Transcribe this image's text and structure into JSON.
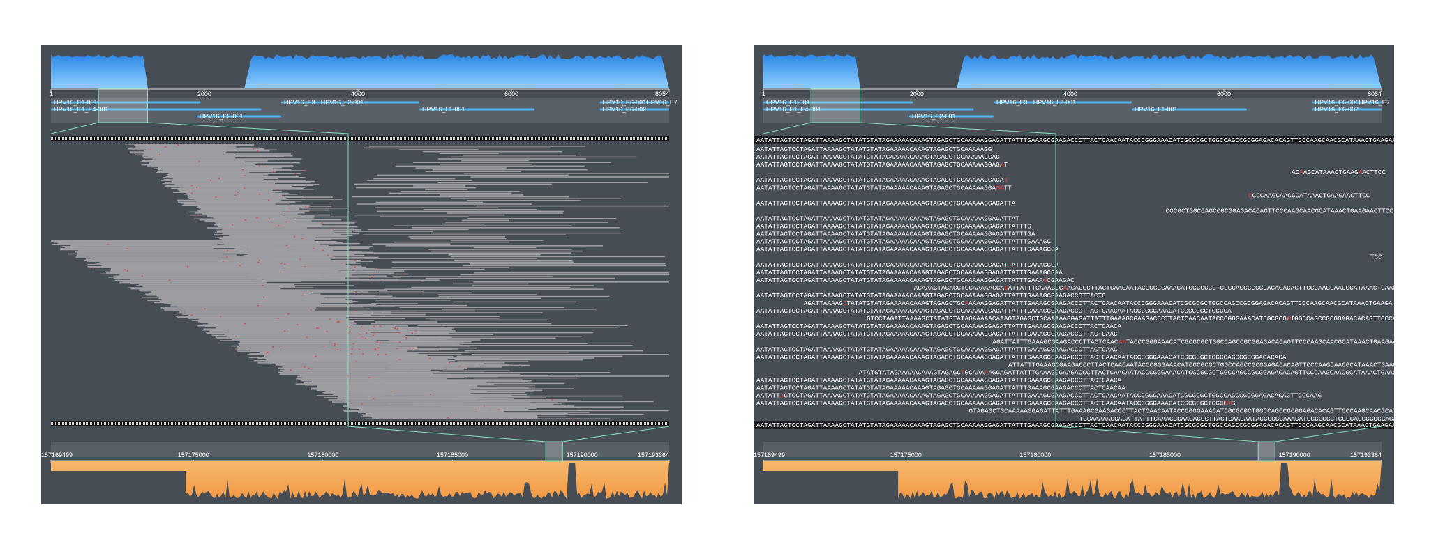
{
  "colors": {
    "panel_bg": "#474d55",
    "coverage_top": "#3d9bef",
    "coverage_bottom": "#f5a85a",
    "gene_track": "#4fb6f0",
    "read": "#9e9ea2",
    "mismatch": "#e0443a",
    "connector": "#7fe0b8"
  },
  "left_view": {
    "mode": "alignment-overview"
  },
  "right_view": {
    "mode": "sequence-detail"
  },
  "top_axis": {
    "ticks": [
      "1",
      "2000",
      "4000",
      "6000",
      "8054"
    ],
    "tick_values": [
      1,
      2000,
      4000,
      6000,
      8054
    ],
    "max": 8054,
    "coverage_gap": [
      1260,
      2520
    ],
    "selection": [
      620,
      1260
    ]
  },
  "genes": [
    {
      "label": "HPV16_E1-001",
      "start": 1,
      "end": 1950,
      "row": 0
    },
    {
      "label": "HPV16_E1_E4-001",
      "start": 1,
      "end": 2740,
      "row": 1
    },
    {
      "label": "HPV16_E2-001",
      "start": 1900,
      "end": 3000,
      "row": 2
    },
    {
      "label": "HPV16_E3",
      "start": 3000,
      "end": 3540,
      "row": 0
    },
    {
      "label": "HPV16_L2-001",
      "start": 3480,
      "end": 4800,
      "row": 0
    },
    {
      "label": "HPV16_L1-001",
      "start": 4800,
      "end": 6300,
      "row": 1
    },
    {
      "label": "HPV16_E6-001",
      "start": 7150,
      "end": 7720,
      "row": 0
    },
    {
      "label": "HPV16_E7",
      "start": 7720,
      "end": 8054,
      "row": 0
    },
    {
      "label": "HPV16_E6-002",
      "start": 7150,
      "end": 8054,
      "row": 1
    }
  ],
  "bottom_axis": {
    "ticks": [
      "157169499",
      "157175000",
      "157180000",
      "157185000",
      "157190000",
      "157193364"
    ],
    "tick_values": [
      157169499,
      157175000,
      157180000,
      157185000,
      157190000,
      157193364
    ],
    "min": 157169499,
    "max": 157193364,
    "selection": [
      157188600,
      157189250
    ],
    "coverage_step": 157174700
  },
  "sequences": {
    "reference": "AATATTAGTCCTAGATTAAAAGCTATATGTATAGAAAAACAAAGTAGAGCTGCAAAAAGGAGATTATTTGAAAGCGAAGACCCTTACTCAACAATACCCGGGAAACATCGCGCGCTGGCCAGCCGCGGAGACACAGTTCCCAAGCAACGCATAAACTGAAGAACTTCC",
    "reads": [
      {
        "offset": 0,
        "text": "AATATTAGTCCTAGATTAAAAGCTATATGTATAGAAAAACAAAGTAGAGCTGCAAAAAGG",
        "mismatch": []
      },
      {
        "offset": 0,
        "text": "AATATTAGTCCTAGATTAAAAGCTATATGTATAGAAAAACAAAGTAGAGCTGCAAAAAGGAG",
        "mismatch": []
      },
      {
        "offset": 0,
        "text": "AATATTAGTCCTAGATTAAAAGCTATATGTATAGAAAAACAAAGTAGAGCTGCAAAAAGGAGAT",
        "mismatch": [
          62
        ]
      },
      {
        "offset": 136,
        "text": "ACAAGCATAAACTGAAGAACTTCC",
        "mismatch": [
          2,
          17
        ]
      },
      {
        "offset": 0,
        "text": "AATATTAGTCCTAGATTAAAAGCTATATGTATAGAAAAACAAAGTAGAGCTGCAAAAAGGAGAT",
        "mismatch": [
          63
        ]
      },
      {
        "offset": 0,
        "text": "AATATTAGTCCTAGATTAAAAGCTATATGTATAGAAAAACAAAGTAGAGCTGCAAAAAGGAGATT",
        "mismatch": [
          61,
          62
        ]
      },
      {
        "offset": 125,
        "text": "CCCCAAGCAACGCATAAACTGAAGAACTTCC",
        "mismatch": [
          0
        ]
      },
      {
        "offset": 0,
        "text": "AATATTAGTCCTAGATTAAAAGCTATATGTATAGAAAAACAAAGTAGAGCTGCAAAAAGGAGATTA",
        "mismatch": []
      },
      {
        "offset": 104,
        "text": "CGCGCTGGCCAGCCGCGGAGACACAGTTCCCAAGCAACGCATAAACTGAAGAACTTCC",
        "mismatch": []
      },
      {
        "offset": 0,
        "text": "AATATTAGTCCTAGATTAAAAGCTATATGTATAGAAAAACAAAGTAGAGCTGCAAAAAGGAGATTAT",
        "mismatch": []
      },
      {
        "offset": 0,
        "text": "AATATTAGTCCTAGATTAAAAGCTATATGTATAGAAAAACAAAGTAGAGCTGCAAAAAGGAGATTATTTG",
        "mismatch": []
      },
      {
        "offset": 0,
        "text": "AATATTAGTCCTAGATTAAAAGCTATATGTATAGAAAAACAAAGTAGAGCTGCAAAAAGGAGATTATTTGA",
        "mismatch": []
      },
      {
        "offset": 0,
        "text": "AATATTAGTCCTAGATTAAAAGCTATATGTATAGAAAAACAAAGTAGAGCTGCAAAAAGGAGATTATTTGAAAGC",
        "mismatch": []
      },
      {
        "offset": 0,
        "text": "AATATTAGTCCTAGATTAAAAGCTATATGTATAGAAAAACAAAGTAGAGCTGCAAAAAGGAGATTATTTGAAAGCGA",
        "mismatch": []
      },
      {
        "offset": 156,
        "text": "TCC",
        "mismatch": []
      },
      {
        "offset": 0,
        "text": "AATATTAGTCCTAGATTAAAAGCTATATGTATAGAAAAACAAAGTAGAGCTGCAAAAAGGAGATTATTTGAAAGCGA",
        "mismatch": [
          64
        ]
      },
      {
        "offset": 0,
        "text": "AATATTAGTCCTAGATTAAAAGCTATATGTATAGAAAAACAAAGTAGAGCTGCAAAAAGGAGATTATTTGAAAGCGAA",
        "mismatch": []
      },
      {
        "offset": 0,
        "text": "AATATTAGTCCTAGATTAAAAGCTATATGTATAGAAAAACAAAGTAGAGCTGCAAAAAGGAGATTATTTGAAAGCGAAGAC",
        "mismatch": [
          73
        ]
      },
      {
        "offset": 40,
        "text": "ACAAAGTAGAGCTGCAAAAAGGAGATTATTTGAAAGCGAAGACCCTTACTCAACAATACCCGGGAAACATCGCGCGCTGGCCAGCCGCGGAGACACAGTTCCCAAGCAACGCATAAACTGAAGAACTTCC",
        "mismatch": [
          23,
          38
        ]
      },
      {
        "offset": 0,
        "text": "AATATTAGTCCTAGATTAAAAGCTATATGTATAGAAAAACAAAGTAGAGCTGCAAAAAGGAGATTATTTGAAAGCGAAGACCCTTACTC",
        "mismatch": []
      },
      {
        "offset": 12,
        "text": "AGATTAAAAGCTATATGTATAGAAAAACAAAGTAGAGCTGCAAAAAGGAGATTATTTGAAAGCGAAGACCCTTACTCAACAATACCCGGGAAACATCGCGCGCTGGCCAGCCGCGGAGACACAGTTCCCAAGCAACGCATAAACTGAAGA",
        "mismatch": [
          10,
          41
        ]
      },
      {
        "offset": 0,
        "text": "AATATTAGTCCTAGATTAAAAGCTATATGTATAGAAAAACAAAGTAGAGCTGCAAAAAGGAGATTATTTGAAAGCGAAGACCCTTACTCAACAATACCCGGGAAACATCGCGCGCTGGCCA",
        "mismatch": []
      },
      {
        "offset": 28,
        "text": "GTCCTAGATTAAAAGCTATATGTATAGAAAAACAAAGTAGAGCTGCAAAAAGGAGATTATTTGAAAGCGAAGACCCTTACTCAACAATACCCGGGAAACATCGCGCGCTGGCCAGCCGCGGAGACACAGTTCCCAAGCAACGCATAAACT",
        "mismatch": [
          107
        ]
      },
      {
        "offset": 0,
        "text": "AATATTAGTCCTAGATTAAAAGCTATATGTATAGAAAAACAAAGTAGAGCTGCAAAAAGGAGATTATTTGAAAGCGAAGACCCTTACTCAACA",
        "mismatch": []
      },
      {
        "offset": 0,
        "text": "AATATTAGTCCTAGATTAAAAGCTATATGTATAGAAAAACAAAGTAGAGCTGCAAAAAGGAGATTATTTGAAAGCGAAGACCCTTACTCAAC",
        "mismatch": []
      },
      {
        "offset": 60,
        "text": "AGATTATTTGAAAGCGAAGACCCTTACTCAACAATACCCGGGAAACATCGCGCGCTGGCCAGCCGCGGAGACACAGTTCCCAAGCAACGCATAAACTGAAGAACTTCC",
        "mismatch": [
          32,
          33
        ]
      },
      {
        "offset": 0,
        "text": "AATATTAGTCCTAGATTAAAAGCTATATGTATAGAAAAACAAAGTAGAGCTGCAAAAAGGAGATTATTTGAAAGCGAAGACCCTTACTCAAC",
        "mismatch": []
      },
      {
        "offset": 0,
        "text": "AATATTAGTCCTAGATTAAAAGCTATATGTATAGAAAAACAAAGTAGAGCTGCAAAAAGGAGATTATTTGAAAGCGAAGACCCTTACTCAACAATACCCGGGAAACATCGCGCGCTGGCCAGCCGCGGAGACACA",
        "mismatch": []
      },
      {
        "offset": 64,
        "text": "ATTATTTGAAAGCGAAGACCCTTACTCAACAATACCCGGGAAACATCGCGCGCTGGCCAGCCGCGGAGACACAGTTCCCAAGCAACGCATAAACTGAAGAACTTCC",
        "mismatch": []
      },
      {
        "offset": 26,
        "text": "ATATGTATAGAAAAACAAAGTAGAGCTGCAAAAAGGAGATTATTTGAAAGCGAAGACCCTTACTCAACAATACCCGGGAAACATCGCGCGCTGGCCAGCCGCGGAGACACAGTTCCCAAGCAACGCATAAACTGAAGAACTTCC",
        "mismatch": [
          26,
          32
        ]
      },
      {
        "offset": 0,
        "text": "AATATTAGTCCTAGATTAAAAGCTATATGTATAGAAAAACAAAGTAGAGCTGCAAAAAGGAGATTATTTGAAAGCGAAGACCCTTACTCAACA",
        "mismatch": []
      },
      {
        "offset": 0,
        "text": "AATATTAGTCCTAGATTAAAAGCTATATGTATAGAAAAACAAAGTAGAGCTGCAAAAAGGAGATTATTTGAAAGCGAAGACCCTTACTCAACAA",
        "mismatch": []
      },
      {
        "offset": 0,
        "text": "AATATTAGTCCTAGATTAAAAGCTATATGTATAGAAAAACAAAGTAGAGCTGCAAAAAGGAGATTATTTGAAAGCGAAGACCCTTACTCAACAATACCCGGGAAACATCGCGCGCTGGCCAGCCGCGGAGACACAGTTCCCAAG",
        "mismatch": [
          6
        ]
      },
      {
        "offset": 0,
        "text": "AATATTAGTCCTAGATTAAAAGCTATATGTATAGAAAAACAAAGTAGAGCTGCAAAAAGGAGATTATTTGAAAGCGAAGACCCTTACTCAACAATACCCGGGAAACATCGCGCGCTGGCCAG",
        "mismatch": [
          119,
          120
        ]
      },
      {
        "offset": 54,
        "text": "GTAGAGCTGCAAAAAGGAGATTATTTGAAAGCGAAGACCCTTACTCAACAATACCCGGGAAACATCGCGCGCTGGCCAGCCGCGGAGACACAGTTCCCAAGCAACGCATAAACTGAAGAACTTCC",
        "mismatch": []
      },
      {
        "offset": 82,
        "text": "TGCAAAAAGGAGATTATTTGAAAGCGAAGACCCTTACTCAACAATACCCGGGAAACATCGCGCGCTGGCCAGCCGCGGAGACACAGTTCCCAAGCAACGCATAAACTGAAGAACTTCC",
        "mismatch": []
      },
      {
        "offset": 16,
        "text": "TAAAAGCTATATGTATAGAAAAACAAAGTAGAGCTGCAAAAAGGAGATTATTTGAAAGCGAAGACCCTTACTCAACAATACCCGGGAAACATCGCGCGCTGGCCAGCCGCGGAGACACAGTTCCCAAGCAACGCATAAACTGAAGAACTT",
        "mismatch": []
      }
    ]
  }
}
